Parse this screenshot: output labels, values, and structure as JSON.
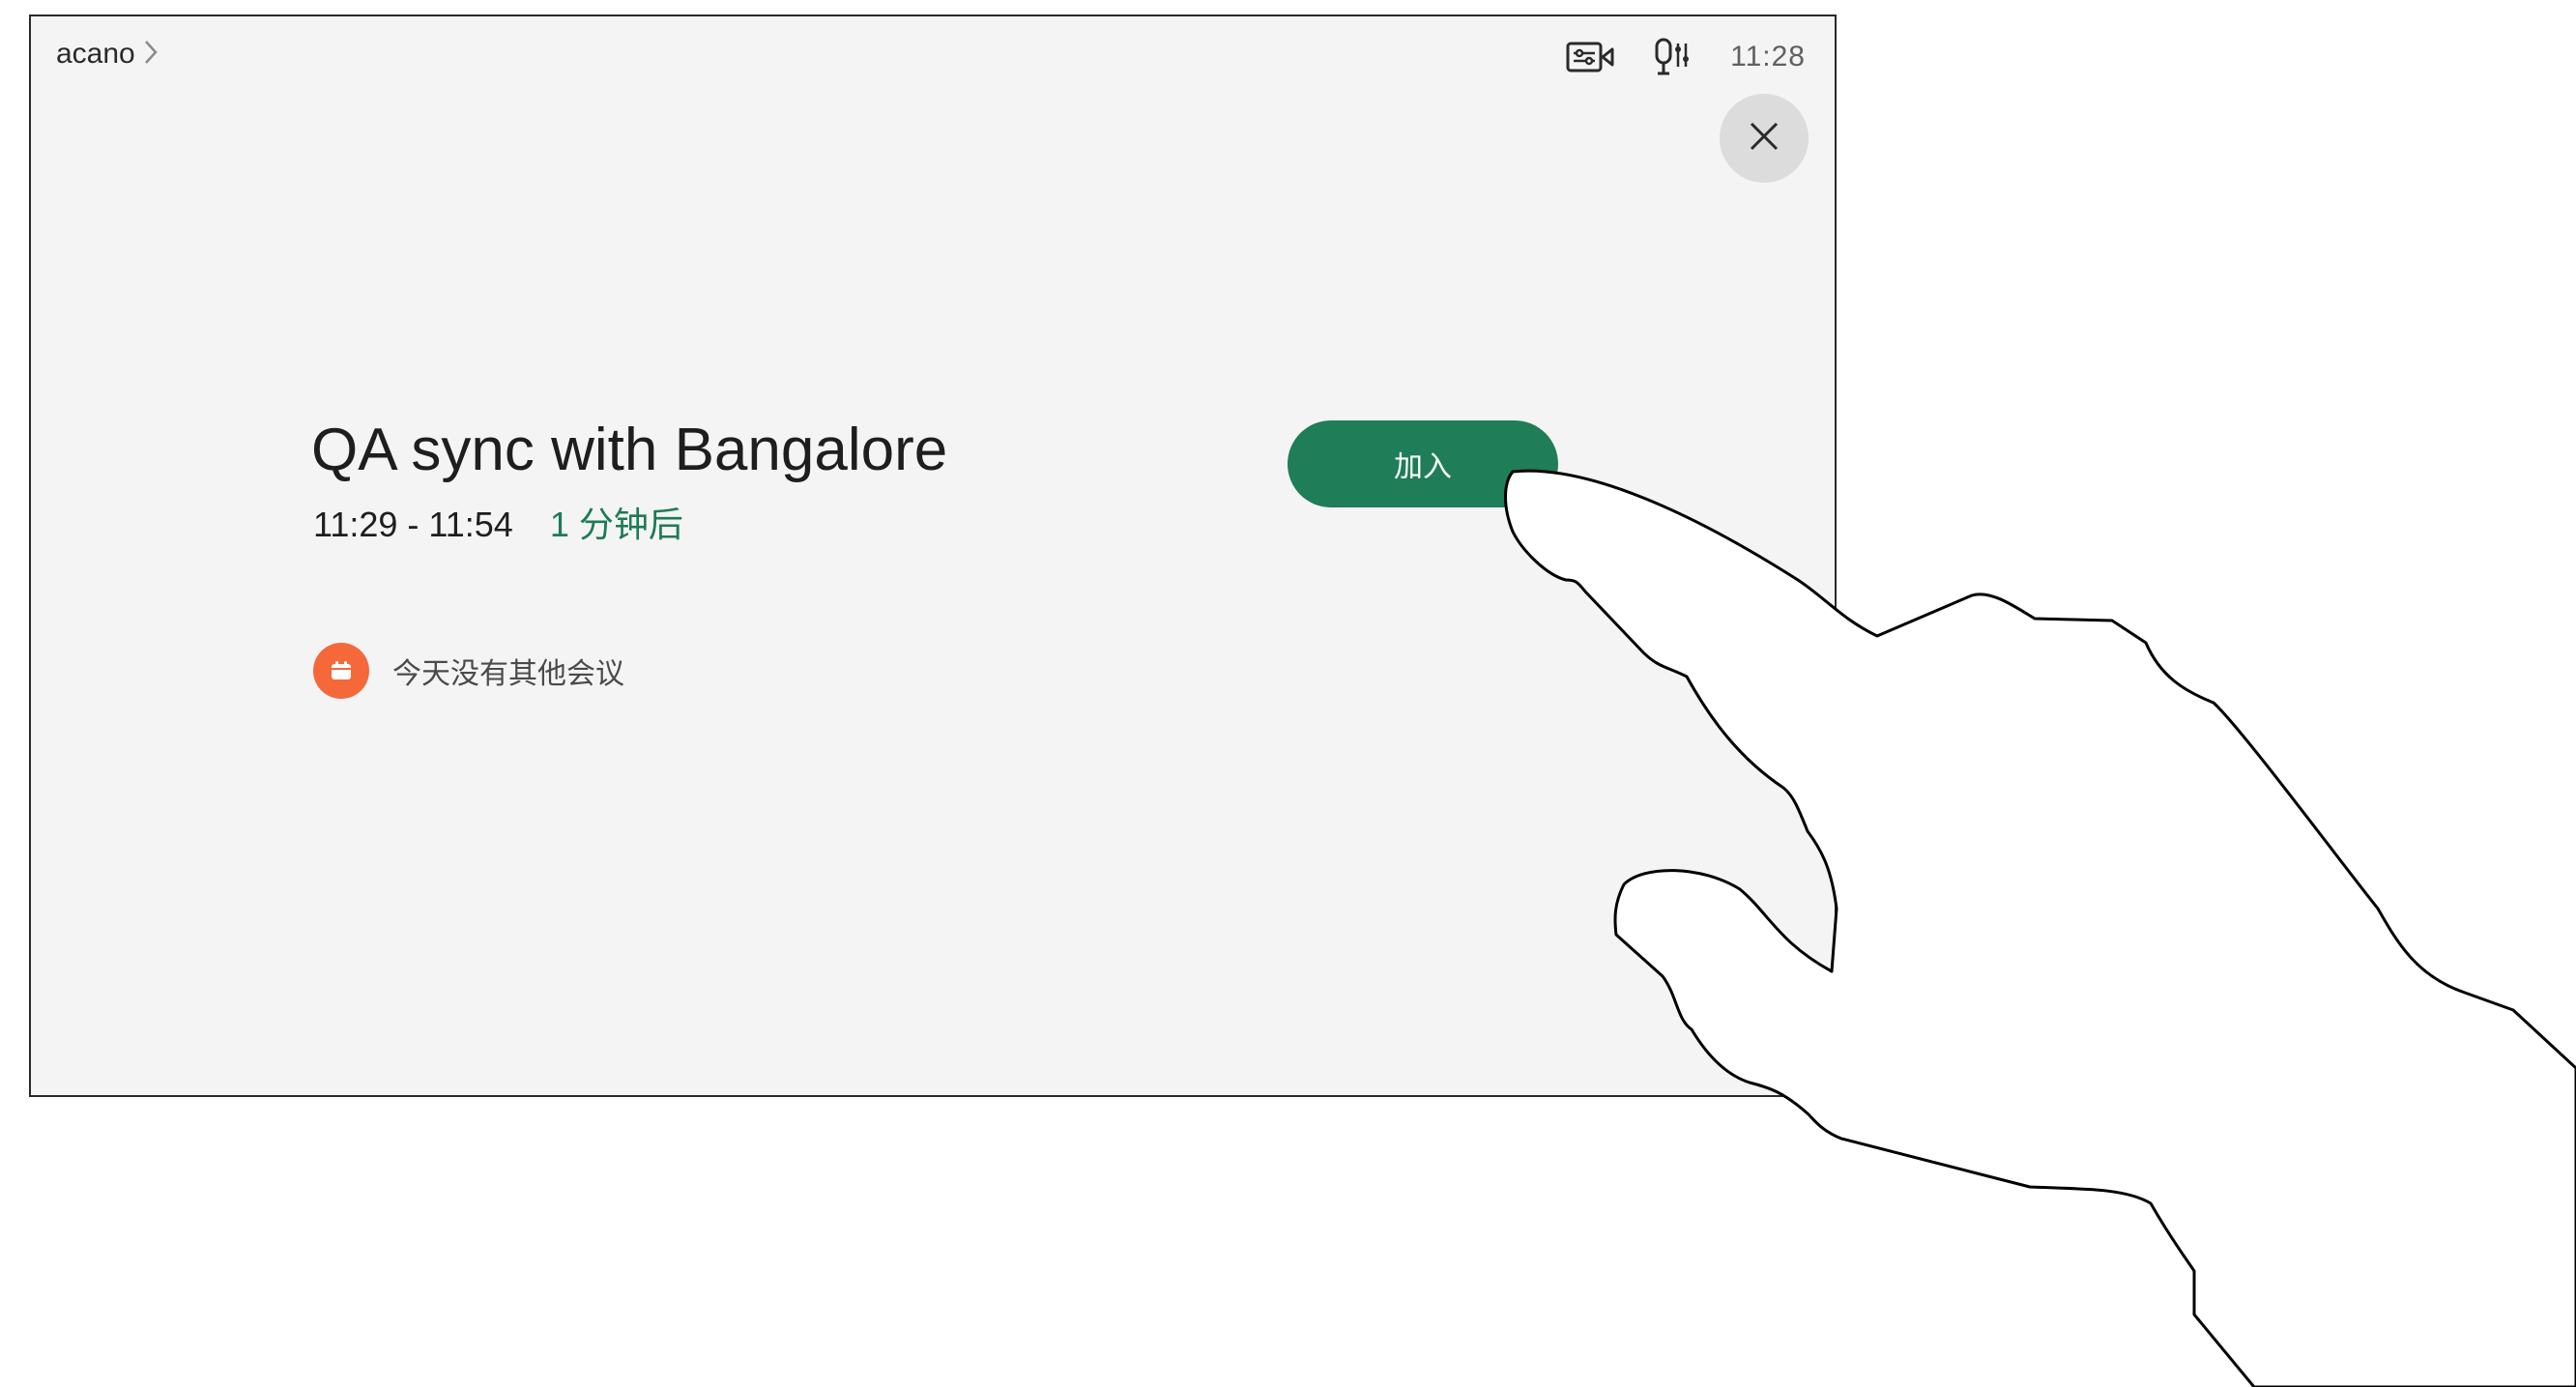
{
  "header": {
    "breadcrumb": "acano",
    "time": "11:28"
  },
  "meeting": {
    "title": "QA sync with Bangalore",
    "time_range": "11:29 - 11:54",
    "countdown": "1 分钟后",
    "join_label": "加入"
  },
  "agenda": {
    "message": "今天没有其他会议"
  },
  "icons": {
    "camera": "camera-settings-icon",
    "mic": "microphone-settings-icon",
    "close": "close-icon",
    "calendar": "calendar-icon",
    "chevron": "chevron-right-icon"
  },
  "colors": {
    "join": "#1f7d57",
    "countdown": "#1d7a55",
    "calendar_badge": "#f5683a",
    "screen_bg": "#f4f4f4"
  }
}
